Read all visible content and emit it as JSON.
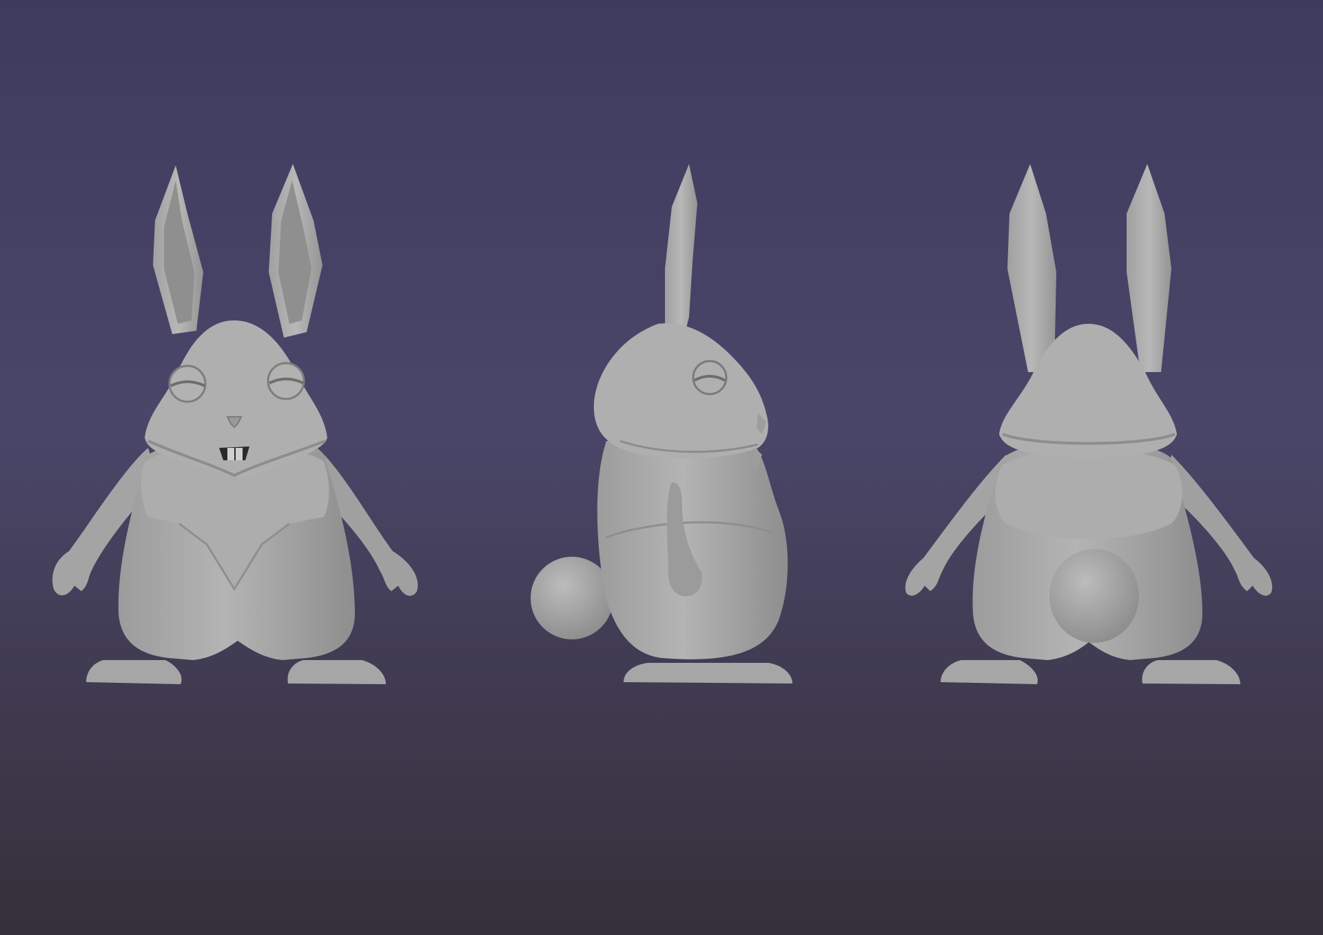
{
  "scene": {
    "description_visible_text": "",
    "views": [
      {
        "view": "front"
      },
      {
        "view": "side"
      },
      {
        "view": "back"
      }
    ]
  },
  "colors": {
    "background_top": "#3f3b5e",
    "background_mid": "#4a4669",
    "background_bottom": "#36303a",
    "model_base": "#a9a9a9",
    "model_light": "#bdbdbd",
    "model_shadow": "#8a8a8a",
    "model_dark": "#6f6f6f"
  }
}
